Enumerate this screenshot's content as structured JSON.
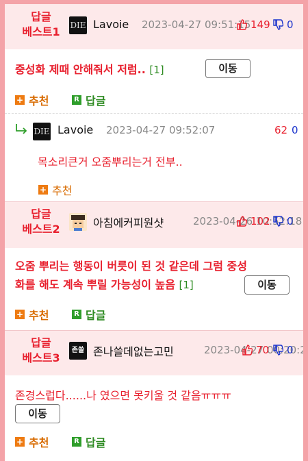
{
  "items": [
    {
      "best_line1": "답글",
      "best_line2": "베스트1",
      "nick": "Lavoie",
      "date": "2023-04-27 09:51:15",
      "likes": "149",
      "dislikes": "0",
      "text": "중성화 제때 안해줘서 저럼..",
      "reply_count": "[1]",
      "move_label": "이동",
      "recommend_label": "추천",
      "reply_label": "답글",
      "avatar_text": "DIE"
    },
    {
      "best_line1": "답글",
      "best_line2": "베스트2",
      "nick": "아침에커피원샷",
      "date": "2023-04-26 10:52:18",
      "likes": "102",
      "dislikes": "0",
      "text_line1": "오줌 뿌리는 행동이 버릇이 된 것 같은데 그럼 중성",
      "text_line2": "화를 해도 계속 뿌릴 가능성이 높음",
      "reply_count": "[1]",
      "move_label": "이동",
      "recommend_label": "추천",
      "reply_label": "답글"
    },
    {
      "best_line1": "답글",
      "best_line2": "베스트3",
      "nick": "존나쓸데없는고민",
      "date": "2023-04-27 00:20:20",
      "likes": "70",
      "dislikes": "0",
      "text": "존경스럽다......나 였으면 못키울 것 같음ㅠㅠㅠ",
      "move_label": "이동",
      "recommend_label": "추천",
      "reply_label": "답글",
      "avatar_text": "존쓸"
    }
  ],
  "reply": {
    "nick": "Lavoie",
    "date": "2023-04-27 09:52:07",
    "likes": "62",
    "dislikes": "0",
    "text": "목소리큰거 오줌뿌리는거 전부..",
    "recommend_label": "추천",
    "avatar_text": "DIE"
  },
  "colors": {
    "accent": "#e8202e",
    "header_bg": "#fde9ea",
    "frame": "#f4a3a8",
    "green": "#2e8b22",
    "blue": "#1a33cc"
  }
}
